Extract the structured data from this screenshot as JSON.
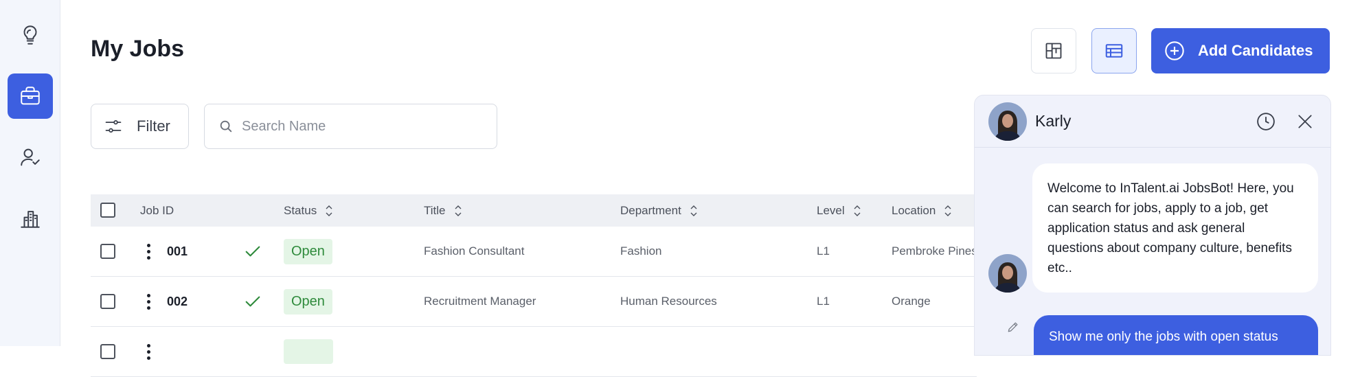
{
  "page": {
    "title": "My Jobs"
  },
  "sidebar": {
    "items": [
      {
        "icon": "lightbulb-icon",
        "active": false
      },
      {
        "icon": "briefcase-icon",
        "active": true
      },
      {
        "icon": "user-check-icon",
        "active": false
      },
      {
        "icon": "buildings-icon",
        "active": false
      }
    ]
  },
  "header": {
    "add_candidates_label": "Add Candidates",
    "view_toggle": {
      "kanban_icon": "kanban-icon",
      "table_icon": "table-icon",
      "active": "table"
    }
  },
  "toolbar": {
    "filter_label": "Filter",
    "search_placeholder": "Search Name"
  },
  "table": {
    "columns": [
      "Job ID",
      "Status",
      "Title",
      "Department",
      "Level",
      "Location"
    ],
    "rows": [
      {
        "id": "001",
        "status": "Open",
        "title": "Fashion Consultant",
        "department": "Fashion",
        "level": "L1",
        "location": "Pembroke Pines"
      },
      {
        "id": "002",
        "status": "Open",
        "title": "Recruitment Manager",
        "department": "Human Resources",
        "level": "L1",
        "location": "Orange"
      },
      {
        "id": "",
        "status": "",
        "title": "",
        "department": "",
        "level": "",
        "location": ""
      }
    ]
  },
  "chat": {
    "name": "Karly",
    "messages": [
      {
        "from": "bot",
        "text": "Welcome to InTalent.ai JobsBot! Here, you can search for jobs, apply to a job, get application status and ask general questions about company culture, benefits etc.."
      },
      {
        "from": "user",
        "text": "Show me only the jobs with open status"
      }
    ]
  },
  "colors": {
    "accent": "#3d5fe0",
    "open_badge_bg": "#e4f5e6",
    "open_badge_text": "#2e8a3b",
    "sidebar_bg": "#f3f6fc"
  }
}
